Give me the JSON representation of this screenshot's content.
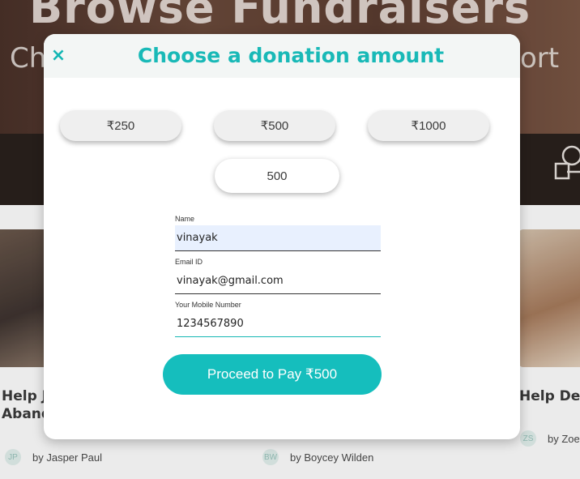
{
  "background": {
    "hero_title": "Browse Fundraisers",
    "hero_subtitle_left": "Ch",
    "hero_subtitle_right": "ort",
    "cards": [
      {
        "title_line1": "Help J",
        "title_line2": "Aband",
        "author": "by Jasper Paul",
        "initials": "JP"
      },
      {
        "author": "by Boycey Wilden",
        "initials": "BW"
      },
      {
        "title_line1": "Help Devi",
        "author": "by Zoe",
        "initials": "ZS"
      }
    ]
  },
  "modal": {
    "close_glyph": "×",
    "title": "Choose a donation amount",
    "amount_options": [
      "₹250",
      "₹500",
      "₹1000"
    ],
    "custom_amount_value": "500",
    "form": {
      "name_label": "Name",
      "name_value": "vinayak",
      "email_label": "Email ID",
      "email_value": "vinayak@gmail.com",
      "mobile_label": "Your Mobile Number",
      "mobile_value": "1234567890"
    },
    "pay_button_label": "Proceed to Pay ₹500"
  },
  "colors": {
    "accent": "#15bebd",
    "title_color": "#19b9b7",
    "autofill": "#e8f0fe"
  }
}
